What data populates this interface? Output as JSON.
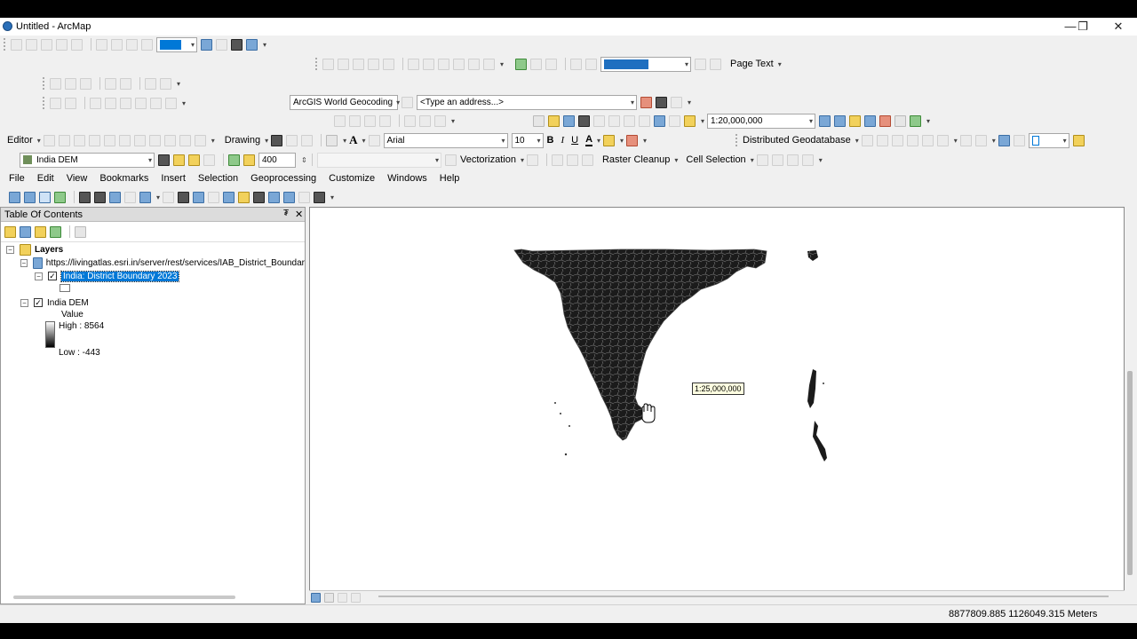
{
  "window": {
    "title": "Untitled - ArcMap",
    "minimize": "—",
    "restore": "❐",
    "close": "✕"
  },
  "toolbars": {
    "page_text": "Page Text",
    "geocoding_service": "ArcGIS World Geocoding",
    "address_placeholder": "<Type an address...>",
    "map_scale": "1:20,000,000",
    "editor": "Editor",
    "drawing": "Drawing",
    "font_name": "Arial",
    "font_size": "10",
    "bold": "B",
    "italic": "I",
    "underline": "U",
    "geodatabase": "Distributed Geodatabase",
    "layer_select": "India DEM",
    "spin_value": "400",
    "vectorization": "Vectorization",
    "raster_cleanup": "Raster Cleanup",
    "cell_selection": "Cell Selection"
  },
  "menu": [
    "File",
    "Edit",
    "View",
    "Bookmarks",
    "Insert",
    "Selection",
    "Geoprocessing",
    "Customize",
    "Windows",
    "Help"
  ],
  "toc": {
    "title": "Table Of Contents",
    "pin": "₮",
    "close": "✕",
    "root": "Layers",
    "service_url": "https://livingatlas.esri.in/server/rest/services/IAB_District_Boundar",
    "district_layer": "India: District Boundary 2023",
    "dem_layer": "India DEM",
    "legend_value": "Value",
    "high": "High : 8564",
    "low": "Low : -443"
  },
  "map": {
    "scale_tooltip": "1:25,000,000"
  },
  "status": {
    "coordinates": "8877809.885  1126049.315 Meters"
  }
}
